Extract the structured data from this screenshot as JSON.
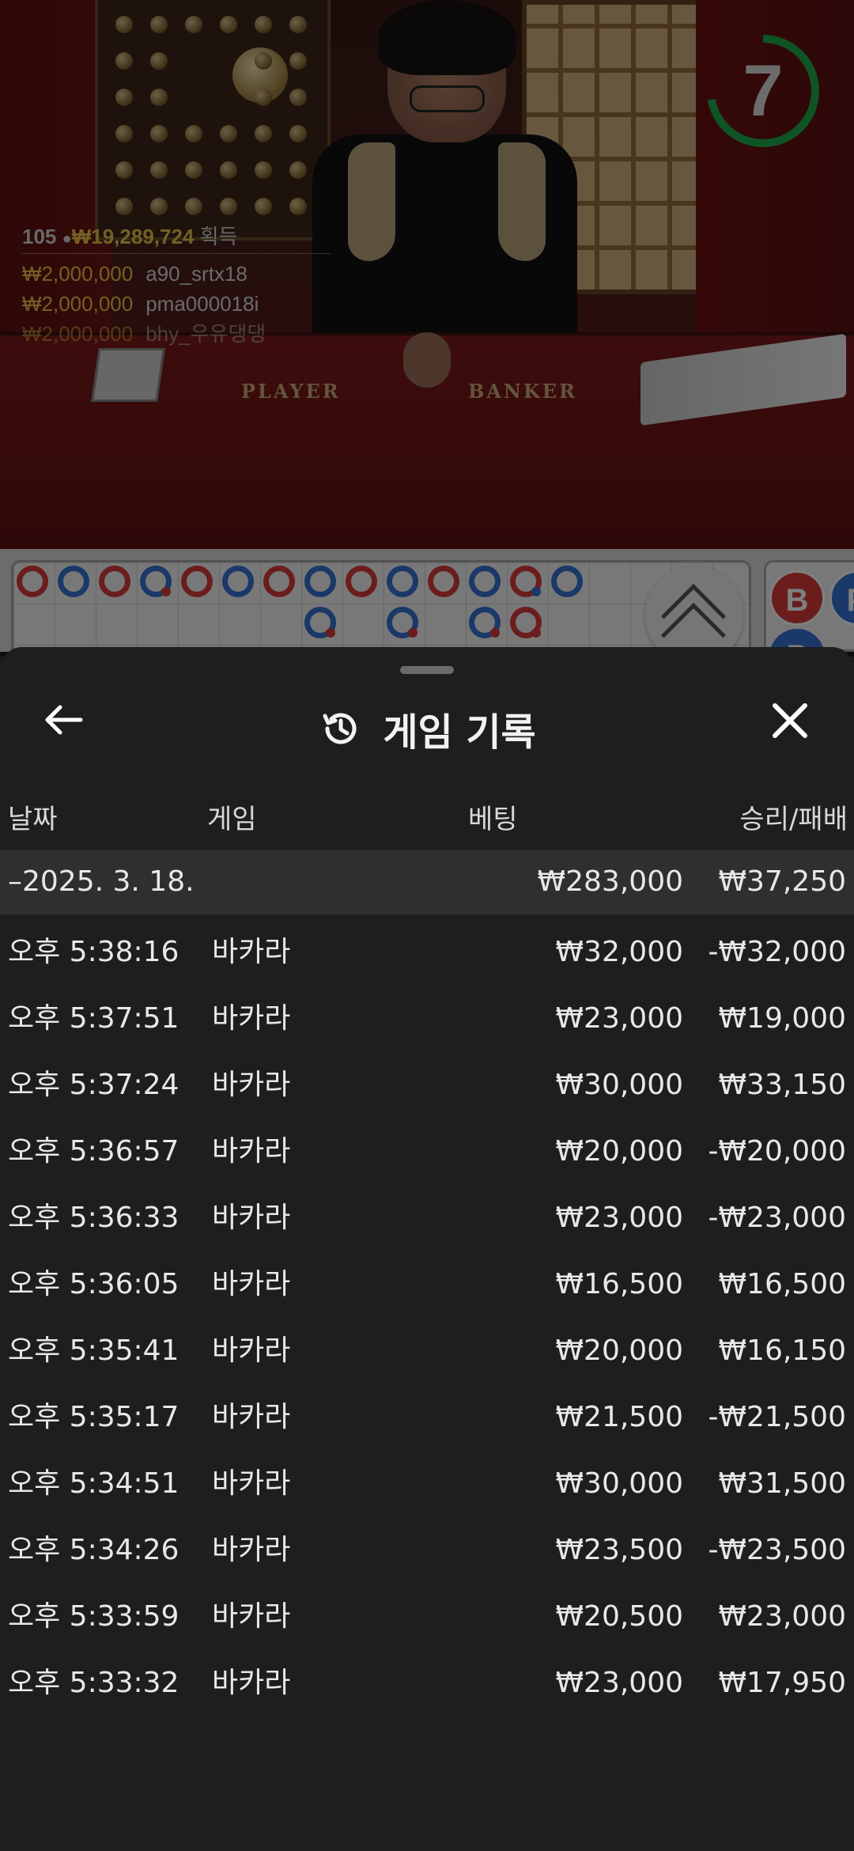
{
  "live": {
    "timer": "7",
    "timer_color": "#1fa84a",
    "table_labels": [
      "PLAYER",
      "BANKER"
    ],
    "winners_total": {
      "count": "105",
      "amount": "₩19,289,724",
      "label": "획득"
    },
    "winners": [
      {
        "amount": "₩2,000,000",
        "name": "a90_srtx18"
      },
      {
        "amount": "₩2,000,000",
        "name": "pma000018i"
      },
      {
        "amount": "₩2,000,000",
        "name": "bhy_우유댕댕"
      }
    ]
  },
  "roadmap": {
    "colors": {
      "banker": "#d63a3a",
      "player": "#3570d1"
    },
    "side_panel": [
      "B",
      "P"
    ]
  },
  "sheet": {
    "title": "게임 기록",
    "icons": {
      "back": "arrow-left-icon",
      "history": "history-icon",
      "close": "close-icon"
    },
    "columns": [
      "날짜",
      "게임",
      "베팅",
      "승리/패배"
    ],
    "summary": {
      "date": "–2025. 3. 18.",
      "bet": "₩283,000",
      "result": "₩37,250"
    },
    "rows": [
      {
        "time": "오후 5:38:16",
        "game": "바카라",
        "bet": "₩32,000",
        "result": "-₩32,000"
      },
      {
        "time": "오후 5:37:51",
        "game": "바카라",
        "bet": "₩23,000",
        "result": "₩19,000"
      },
      {
        "time": "오후 5:37:24",
        "game": "바카라",
        "bet": "₩30,000",
        "result": "₩33,150"
      },
      {
        "time": "오후 5:36:57",
        "game": "바카라",
        "bet": "₩20,000",
        "result": "-₩20,000"
      },
      {
        "time": "오후 5:36:33",
        "game": "바카라",
        "bet": "₩23,000",
        "result": "-₩23,000"
      },
      {
        "time": "오후 5:36:05",
        "game": "바카라",
        "bet": "₩16,500",
        "result": "₩16,500"
      },
      {
        "time": "오후 5:35:41",
        "game": "바카라",
        "bet": "₩20,000",
        "result": "₩16,150"
      },
      {
        "time": "오후 5:35:17",
        "game": "바카라",
        "bet": "₩21,500",
        "result": "-₩21,500"
      },
      {
        "time": "오후 5:34:51",
        "game": "바카라",
        "bet": "₩30,000",
        "result": "₩31,500"
      },
      {
        "time": "오후 5:34:26",
        "game": "바카라",
        "bet": "₩23,500",
        "result": "-₩23,500"
      },
      {
        "time": "오후 5:33:59",
        "game": "바카라",
        "bet": "₩20,500",
        "result": "₩23,000"
      },
      {
        "time": "오후 5:33:32",
        "game": "바카라",
        "bet": "₩23,000",
        "result": "₩17,950"
      }
    ]
  }
}
